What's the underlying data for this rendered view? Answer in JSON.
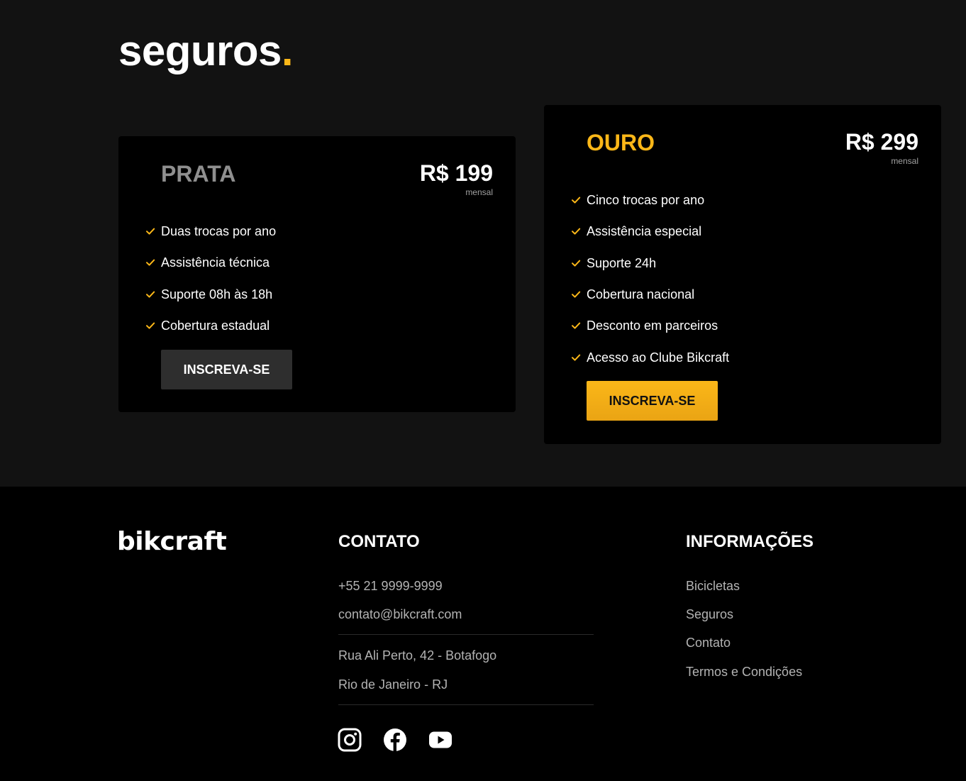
{
  "page": {
    "title": "seguros",
    "title_dot": "."
  },
  "plans": [
    {
      "name": "PRATA",
      "price": "R$ 199",
      "period": "mensal",
      "features": [
        "Duas trocas por ano",
        "Assistência técnica",
        "Suporte 08h às 18h",
        "Cobertura estadual"
      ],
      "button": "INSCREVA-SE"
    },
    {
      "name": "OURO",
      "price": "R$ 299",
      "period": "mensal",
      "features": [
        "Cinco trocas por ano",
        "Assistência especial",
        "Suporte 24h",
        "Cobertura nacional",
        "Desconto em parceiros",
        "Acesso ao Clube Bikcraft"
      ],
      "button": "INSCREVA-SE"
    }
  ],
  "footer": {
    "logo": "bikcraft",
    "contato": {
      "title": "CONTATO",
      "phone": "+55 21 9999-9999",
      "email": "contato@bikcraft.com",
      "address": "Rua Ali Perto, 42 - Botafogo",
      "city": "Rio de Janeiro - RJ"
    },
    "social_icons": [
      "instagram-icon",
      "facebook-icon",
      "youtube-icon"
    ],
    "informacoes": {
      "title": "INFORMAÇÕES",
      "links": [
        "Bicicletas",
        "Seguros",
        "Contato",
        "Termos e Condições"
      ]
    }
  },
  "colors": {
    "accent": "#FBB718",
    "page_bg": "#121212",
    "card_bg": "#000000",
    "footer_bg": "#000000"
  }
}
